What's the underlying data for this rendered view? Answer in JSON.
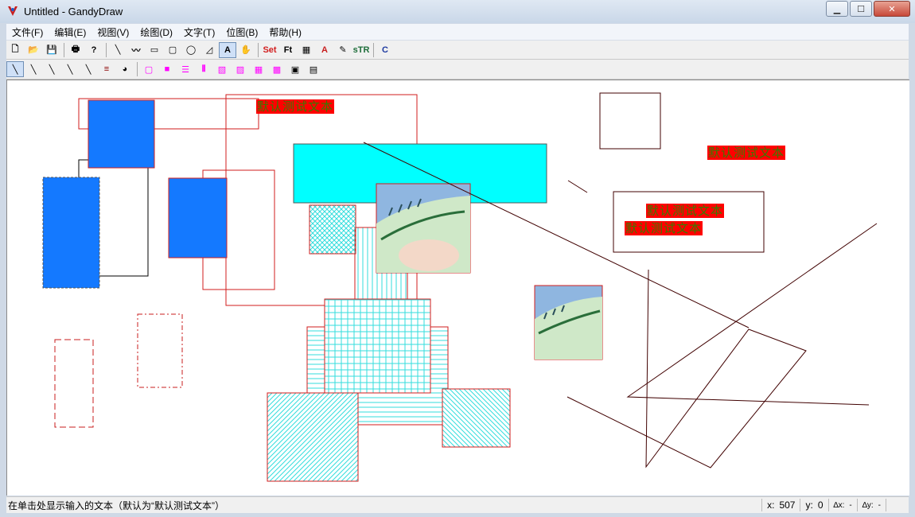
{
  "window": {
    "title": "Untitled - GandyDraw",
    "controls": [
      "min-icon",
      "max-icon",
      "close-icon"
    ]
  },
  "menu": [
    "文件(F)",
    "编辑(E)",
    "视图(V)",
    "绘图(D)",
    "文字(T)",
    "位图(B)",
    "帮助(H)"
  ],
  "toolbar1": {
    "buttons": [
      {
        "name": "new-file-icon",
        "glyph": "🗋"
      },
      {
        "name": "open-folder-icon",
        "glyph": "📂"
      },
      {
        "name": "save-icon",
        "glyph": "💾"
      },
      {
        "name": "print-icon",
        "glyph": "🖶"
      },
      {
        "name": "help-icon",
        "glyph": "?"
      },
      {
        "name": "line-tool-icon",
        "glyph": "╲"
      },
      {
        "name": "polyline-tool-icon",
        "glyph": "〰"
      },
      {
        "name": "rectangle-tool-icon",
        "glyph": "▭"
      },
      {
        "name": "rounded-rect-tool-icon",
        "glyph": "▢"
      },
      {
        "name": "ellipse-tool-icon",
        "glyph": "◯"
      },
      {
        "name": "polygon-tool-icon",
        "glyph": "◿"
      },
      {
        "name": "text-tool-icon",
        "glyph": "A"
      },
      {
        "name": "select-tool-icon",
        "glyph": "✋"
      },
      {
        "name": "set-text-icon",
        "glyph": "Set"
      },
      {
        "name": "font-icon",
        "glyph": "Ft"
      },
      {
        "name": "bitmap-icon",
        "glyph": "▦"
      },
      {
        "name": "text-color-icon",
        "glyph": "A"
      },
      {
        "name": "text-style-icon",
        "glyph": "✎"
      },
      {
        "name": "string-icon",
        "glyph": "sTR"
      },
      {
        "name": "clear-icon",
        "glyph": "C"
      }
    ]
  },
  "toolbar2": {
    "buttons": [
      {
        "name": "line-solid-icon",
        "glyph": "╲"
      },
      {
        "name": "line-dash-icon",
        "glyph": "╲"
      },
      {
        "name": "line-dot-icon",
        "glyph": "╲"
      },
      {
        "name": "line-dashdot-icon",
        "glyph": "╲"
      },
      {
        "name": "line-dashdotdot-icon",
        "glyph": "╲"
      },
      {
        "name": "line-width-icon",
        "glyph": "≡"
      },
      {
        "name": "color-picker-icon",
        "glyph": "◕"
      },
      {
        "name": "fill-none-icon",
        "glyph": "▢"
      },
      {
        "name": "fill-solid-icon",
        "glyph": "■"
      },
      {
        "name": "hatch-horizontal-icon",
        "glyph": "☰"
      },
      {
        "name": "hatch-vertical-icon",
        "glyph": "⦀"
      },
      {
        "name": "hatch-fdiagonal-icon",
        "glyph": "▧"
      },
      {
        "name": "hatch-bdiagonal-icon",
        "glyph": "▨"
      },
      {
        "name": "hatch-cross-icon",
        "glyph": "▦"
      },
      {
        "name": "hatch-diagcross-icon",
        "glyph": "▩"
      },
      {
        "name": "bitmap-fill-icon",
        "glyph": "▣"
      },
      {
        "name": "fill-settings-icon",
        "glyph": "▤"
      }
    ]
  },
  "canvas": {
    "texts": [
      "默认测试文本",
      "默认测试文本",
      "默认测试文本",
      "默认测试文本"
    ],
    "colors": {
      "blue": "#1479ff",
      "cyan": "#00ffff",
      "red": "#d21e1e",
      "dark": "#400000",
      "hatch": "#33dddd"
    }
  },
  "status": {
    "message": "在单击处显示输入的文本（默认为“默认测试文本”）",
    "x_label": "x:",
    "x_value": "507",
    "y_label": "y:",
    "y_value": "0",
    "dx_label": "∆x:",
    "dx_value": "-",
    "dy_label": "∆y:",
    "dy_value": "-"
  }
}
